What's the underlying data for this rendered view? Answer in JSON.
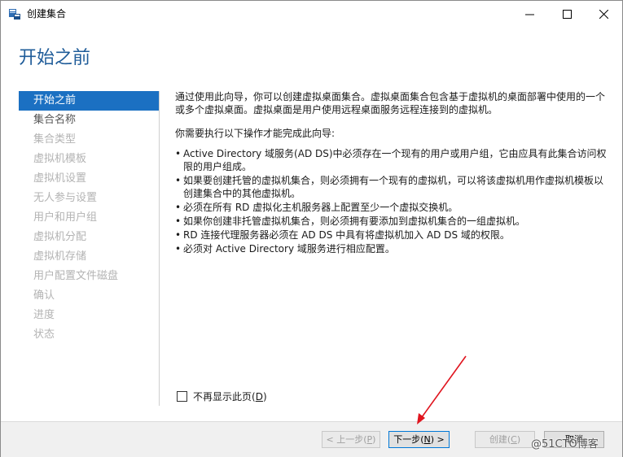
{
  "window": {
    "title": "创建集合",
    "controls": {
      "minimize": "minimize-icon",
      "maximize": "maximize-icon",
      "close": "close-icon"
    }
  },
  "page": {
    "heading": "开始之前"
  },
  "nav": {
    "items": [
      {
        "label": "开始之前",
        "state": "active"
      },
      {
        "label": "集合名称",
        "state": "enabled"
      },
      {
        "label": "集合类型",
        "state": "disabled"
      },
      {
        "label": "虚拟机模板",
        "state": "disabled"
      },
      {
        "label": "虚拟机设置",
        "state": "disabled"
      },
      {
        "label": "无人参与设置",
        "state": "disabled"
      },
      {
        "label": "用户和用户组",
        "state": "disabled"
      },
      {
        "label": "虚拟机分配",
        "state": "disabled"
      },
      {
        "label": "虚拟机存储",
        "state": "disabled"
      },
      {
        "label": "用户配置文件磁盘",
        "state": "disabled"
      },
      {
        "label": "确认",
        "state": "disabled"
      },
      {
        "label": "进度",
        "state": "disabled"
      },
      {
        "label": "状态",
        "state": "disabled"
      }
    ]
  },
  "content": {
    "intro": "通过使用此向导，你可以创建虚拟桌面集合。虚拟桌面集合包含基于虚拟机的桌面部署中使用的一个或多个虚拟桌面。虚拟桌面是用户使用远程桌面服务远程连接到的虚拟机。",
    "requirements_heading": "你需要执行以下操作才能完成此向导:",
    "requirements": [
      "Active Directory 域服务(AD DS)中必须存在一个现有的用户或用户组，它由应具有此集合访问权限的用户组成。",
      "如果要创建托管的虚拟机集合，则必须拥有一个现有的虚拟机，可以将该虚拟机用作虚拟机模板以创建集合中的其他虚拟机。",
      "必须在所有 RD 虚拟化主机服务器上配置至少一个虚拟交换机。",
      "如果你创建非托管虚拟机集合，则必须拥有要添加到虚拟机集合的一组虚拟机。",
      "RD 连接代理服务器必须在 AD DS 中具有将虚拟机加入 AD DS 域的权限。",
      "必须对 Active Directory 域服务进行相应配置。"
    ]
  },
  "dont_show": {
    "label": "不再显示此页(",
    "key": "D",
    "suffix": ")",
    "checked": false
  },
  "buttons": {
    "prev": {
      "text": "< 上一步(",
      "key": "P",
      "suffix": ")"
    },
    "next": {
      "text": "下一步(",
      "key": "N",
      "suffix": ") >"
    },
    "create": {
      "text": "创建(",
      "key": "C",
      "suffix": ")"
    },
    "cancel": {
      "text": "取消"
    }
  },
  "watermark": "@51CTO博客",
  "colors": {
    "accent": "#1b70c2",
    "heading": "#1f5c99",
    "annotation_arrow": "#e0141e"
  }
}
